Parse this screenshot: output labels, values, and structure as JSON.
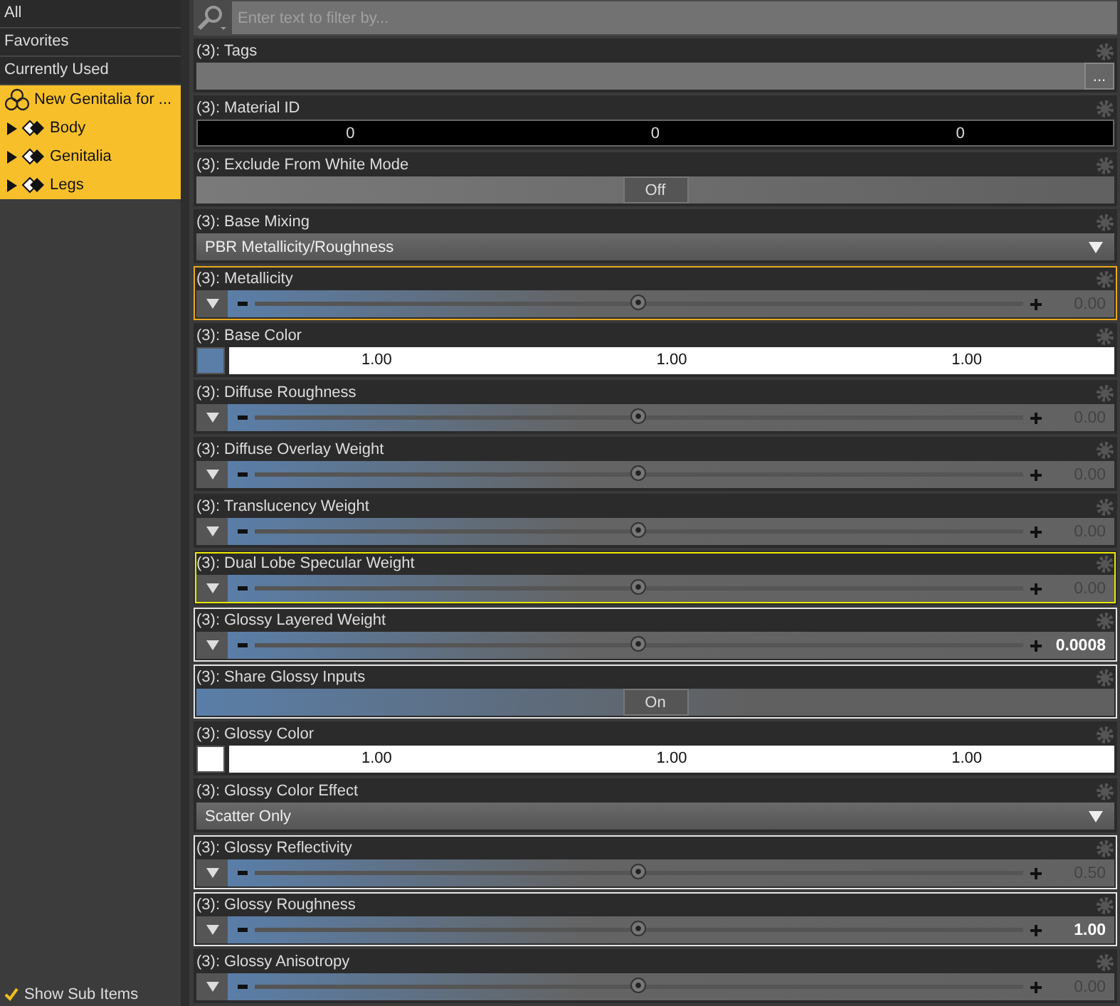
{
  "sidebar": {
    "items": [
      {
        "label": "All",
        "selected": false
      },
      {
        "label": "Favorites",
        "selected": false
      },
      {
        "label": "Currently Used",
        "selected": false
      }
    ],
    "tree": [
      {
        "label": "New Genitalia for ...",
        "selected": true,
        "children": [
          {
            "label": "Body",
            "expanded": false,
            "selected": true
          },
          {
            "label": "Genitalia",
            "expanded": false,
            "selected": true
          },
          {
            "label": "Legs",
            "expanded": false,
            "selected": true
          }
        ]
      }
    ],
    "show_sub_items": {
      "label": "Show Sub Items",
      "checked": true
    }
  },
  "filter": {
    "placeholder": "Enter text to filter by..."
  },
  "properties": [
    {
      "kind": "text",
      "label": "(3): Tags",
      "button": "...",
      "selected": false,
      "hovered": false,
      "highlighted": false
    },
    {
      "kind": "numbers",
      "label": "(3): Material ID",
      "values": [
        "0",
        "0",
        "0"
      ],
      "selected": false,
      "hovered": false,
      "highlighted": false
    },
    {
      "kind": "toggle",
      "label": "(3): Exclude From White Mode",
      "value": "Off",
      "on": false,
      "selected": false,
      "hovered": false,
      "highlighted": false
    },
    {
      "kind": "dropdown",
      "label": "(3): Base Mixing",
      "value": "PBR Metallicity/Roughness",
      "selected": false,
      "hovered": false,
      "highlighted": false
    },
    {
      "kind": "slider",
      "label": "(3): Metallicity",
      "value": "0.00",
      "changed": false,
      "selected": true,
      "hovered": false,
      "highlighted": false
    },
    {
      "kind": "color",
      "label": "(3): Base Color",
      "color": "#5a7ea8",
      "values": [
        "1.00",
        "1.00",
        "1.00"
      ],
      "selected": false,
      "hovered": false,
      "highlighted": false
    },
    {
      "kind": "slider",
      "label": "(3): Diffuse Roughness",
      "value": "0.00",
      "changed": false,
      "selected": false,
      "hovered": false,
      "highlighted": false
    },
    {
      "kind": "slider",
      "label": "(3): Diffuse Overlay Weight",
      "value": "0.00",
      "changed": false,
      "selected": false,
      "hovered": false,
      "highlighted": false
    },
    {
      "kind": "slider",
      "label": "(3): Translucency Weight",
      "value": "0.00",
      "changed": false,
      "selected": false,
      "hovered": false,
      "highlighted": false
    },
    {
      "kind": "slider",
      "label": "(3): Dual Lobe Specular Weight",
      "value": "0.00",
      "changed": false,
      "selected": false,
      "hovered": true,
      "highlighted": false
    },
    {
      "kind": "slider",
      "label": "(3): Glossy Layered Weight",
      "value": "0.0008",
      "changed": true,
      "selected": false,
      "hovered": false,
      "highlighted": true
    },
    {
      "kind": "toggle",
      "label": "(3): Share Glossy Inputs",
      "value": "On",
      "on": true,
      "selected": false,
      "hovered": false,
      "highlighted": true
    },
    {
      "kind": "color",
      "label": "(3): Glossy Color",
      "color": "#ffffff",
      "values": [
        "1.00",
        "1.00",
        "1.00"
      ],
      "selected": false,
      "hovered": false,
      "highlighted": false
    },
    {
      "kind": "dropdown",
      "label": "(3): Glossy Color Effect",
      "value": "Scatter Only",
      "selected": false,
      "hovered": false,
      "highlighted": false
    },
    {
      "kind": "slider",
      "label": "(3): Glossy Reflectivity",
      "value": "0.50",
      "changed": false,
      "selected": false,
      "hovered": false,
      "highlighted": true
    },
    {
      "kind": "slider",
      "label": "(3): Glossy Roughness",
      "value": "1.00",
      "changed": true,
      "selected": false,
      "hovered": false,
      "highlighted": true
    },
    {
      "kind": "slider",
      "label": "(3): Glossy Anisotropy",
      "value": "0.00",
      "changed": false,
      "selected": false,
      "hovered": false,
      "highlighted": false
    }
  ]
}
